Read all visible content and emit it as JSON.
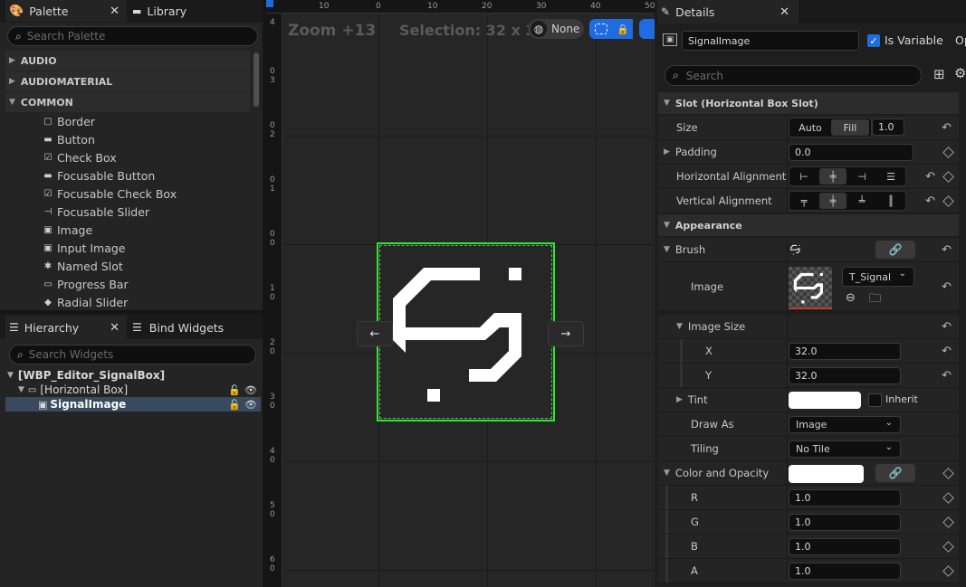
{
  "palette": {
    "tab_label": "Palette",
    "library_tab": "Library",
    "search_placeholder": "Search Palette",
    "categories": [
      "AUDIO",
      "AUDIOMATERIAL",
      "COMMON"
    ],
    "items": [
      "Border",
      "Button",
      "Check Box",
      "Focusable Button",
      "Focusable Check Box",
      "Focusable Slider",
      "Image",
      "Input Image",
      "Named Slot",
      "Progress Bar",
      "Radial Slider"
    ]
  },
  "hierarchy": {
    "tab_label": "Hierarchy",
    "bind_widgets_tab": "Bind Widgets",
    "search_placeholder": "Search Widgets",
    "root": "[WBP_Editor_SignalBox]",
    "child": "[Horizontal Box]",
    "selected": "SignalImage"
  },
  "viewport": {
    "zoom": "Zoom +13",
    "selection": "Selection: 32 x 32",
    "locale_button": "None",
    "ruler_top": [
      "10",
      "0",
      "10",
      "20",
      "30",
      "40",
      "50"
    ],
    "ruler_left": [
      "4",
      "0",
      "3",
      "0",
      "2",
      "0",
      "1",
      "0",
      "0",
      "1",
      "0",
      "2",
      "0",
      "3",
      "0",
      "4",
      "0",
      "5",
      "0",
      "6",
      "0"
    ],
    "arrow_left": "←",
    "arrow_right": "→"
  },
  "details": {
    "tab_label": "Details",
    "widget_name": "SignalImage",
    "is_variable_label": "Is Variable",
    "is_variable": true,
    "cut_label": "Op",
    "search_placeholder": "Search",
    "slot_section": "Slot (Horizontal Box Slot)",
    "size_label": "Size",
    "size_auto": "Auto",
    "size_fill": "Fill",
    "size_value": "1.0",
    "padding_label": "Padding",
    "padding_value": "0.0",
    "halign_label": "Horizontal Alignment",
    "valign_label": "Vertical Alignment",
    "appearance_section": "Appearance",
    "brush_label": "Brush",
    "image_label": "Image",
    "image_asset": "T_Signal",
    "image_size_label": "Image Size",
    "x_label": "X",
    "x_value": "32.0",
    "y_label": "Y",
    "y_value": "32.0",
    "tint_label": "Tint",
    "inherit_label": "Inherit",
    "draw_as_label": "Draw As",
    "draw_as_value": "Image",
    "tiling_label": "Tiling",
    "tiling_value": "No Tile",
    "color_opacity_label": "Color and Opacity",
    "r_label": "R",
    "r_value": "1.0",
    "g_label": "G",
    "g_value": "1.0",
    "b_label": "B",
    "b_value": "1.0",
    "a_label": "A",
    "a_value": "1.0"
  },
  "colors": {
    "selection_green": "#2ee82e",
    "panel_bg": "#242424",
    "accent_blue": "#1e6ce0"
  }
}
